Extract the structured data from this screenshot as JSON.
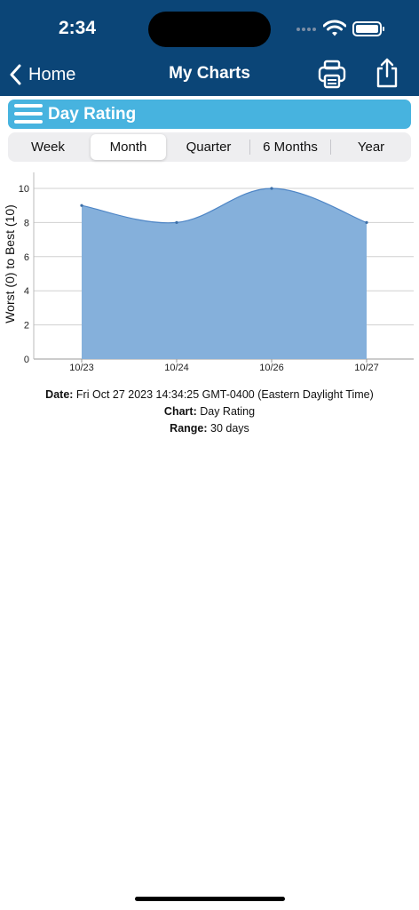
{
  "status_bar": {
    "time": "2:34"
  },
  "nav": {
    "back_label": "Home",
    "title": "My Charts"
  },
  "rating_bar": {
    "title": "Day Rating"
  },
  "segments": {
    "items": [
      "Week",
      "Month",
      "Quarter",
      "6 Months",
      "Year"
    ],
    "selected": "Month"
  },
  "chart_data": {
    "type": "area",
    "categories": [
      "10/23",
      "10/24",
      "10/26",
      "10/27"
    ],
    "values": [
      9,
      8,
      10,
      8
    ],
    "title": "",
    "xlabel": "",
    "ylabel": "Worst (0) to Best (10)",
    "ylim": [
      0,
      10
    ],
    "yticks": [
      0,
      2,
      4,
      6,
      8,
      10
    ],
    "grid": true,
    "fill_color": "#85b0db",
    "line_color": "#4f86c6"
  },
  "info": {
    "date_label": "Date:",
    "date_value": "Fri Oct 27 2023 14:34:25 GMT-0400 (Eastern Daylight Time)",
    "chart_label": "Chart:",
    "chart_value": "Day Rating",
    "range_label": "Range:",
    "range_value": "30 days"
  },
  "colors": {
    "header_bg": "#0b4577",
    "rating_bar_bg": "#47b3df",
    "segment_bg": "#eeeef0"
  }
}
